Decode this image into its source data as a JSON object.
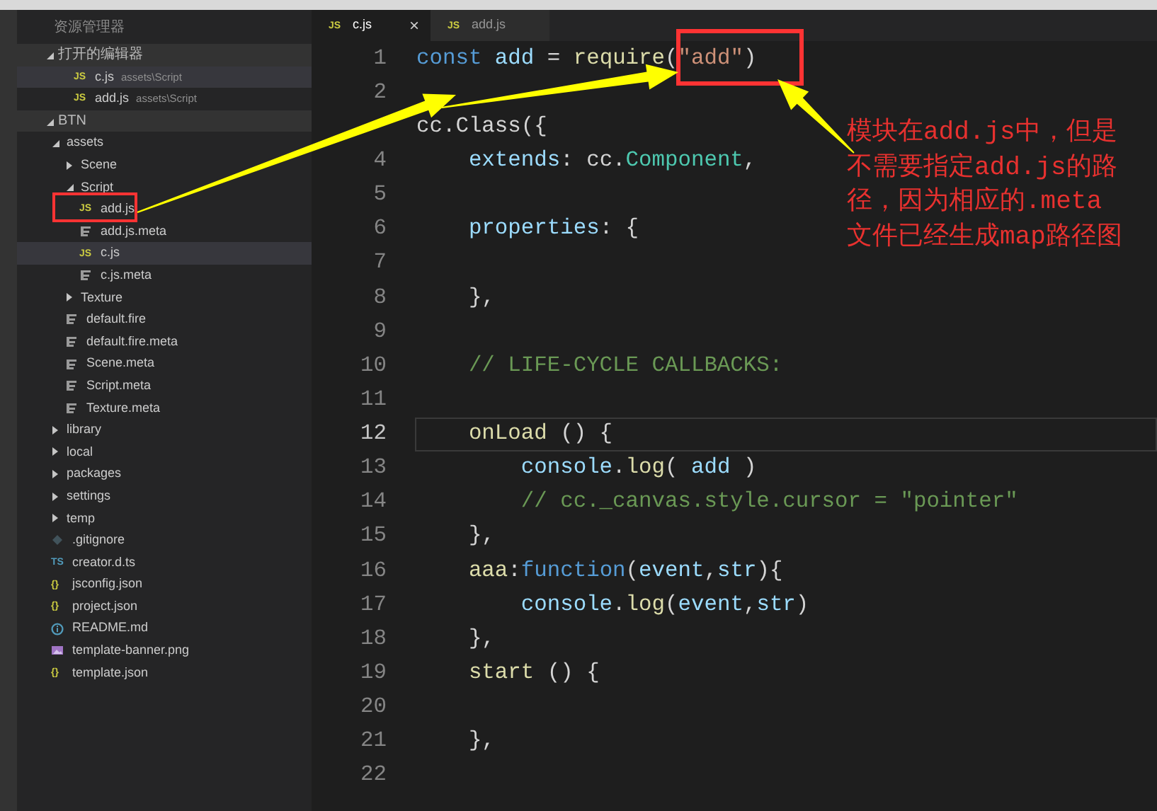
{
  "sidebar": {
    "title": "资源管理器",
    "open_editors": {
      "title": "打开的编辑器",
      "expanded": true,
      "items": [
        {
          "name": "c.js",
          "path": "assets\\Script",
          "kind": "js",
          "icon_text": "JS",
          "selected": true
        },
        {
          "name": "add.js",
          "path": "assets\\Script",
          "kind": "js",
          "icon_text": "JS",
          "selected": false
        }
      ]
    },
    "project": {
      "title": "BTN",
      "expanded": true,
      "children": [
        {
          "name": "assets",
          "kind": "folder",
          "expanded": true,
          "selected": false,
          "children": [
            {
              "name": "Scene",
              "kind": "folder",
              "expanded": false,
              "selected": false
            },
            {
              "name": "Script",
              "kind": "folder",
              "expanded": true,
              "selected": false,
              "children": [
                {
                  "name": "add.js",
                  "kind": "js",
                  "icon_text": "JS",
                  "selected": false
                },
                {
                  "name": "add.js.meta",
                  "kind": "meta",
                  "selected": false
                },
                {
                  "name": "c.js",
                  "kind": "js",
                  "icon_text": "JS",
                  "selected": true
                },
                {
                  "name": "c.js.meta",
                  "kind": "meta",
                  "selected": false
                }
              ]
            },
            {
              "name": "Texture",
              "kind": "folder",
              "expanded": false,
              "selected": false
            },
            {
              "name": "default.fire",
              "kind": "meta",
              "selected": false
            },
            {
              "name": "default.fire.meta",
              "kind": "meta",
              "selected": false
            },
            {
              "name": "Scene.meta",
              "kind": "meta",
              "selected": false
            },
            {
              "name": "Script.meta",
              "kind": "meta",
              "selected": false
            },
            {
              "name": "Texture.meta",
              "kind": "meta",
              "selected": false
            }
          ]
        },
        {
          "name": "library",
          "kind": "folder",
          "expanded": false,
          "selected": false
        },
        {
          "name": "local",
          "kind": "folder",
          "expanded": false,
          "selected": false
        },
        {
          "name": "packages",
          "kind": "folder",
          "expanded": false,
          "selected": false
        },
        {
          "name": "settings",
          "kind": "folder",
          "expanded": false,
          "selected": false
        },
        {
          "name": "temp",
          "kind": "folder",
          "expanded": false,
          "selected": false
        },
        {
          "name": ".gitignore",
          "kind": "git",
          "selected": false
        },
        {
          "name": "creator.d.ts",
          "kind": "ts",
          "icon_text": "TS",
          "selected": false
        },
        {
          "name": "jsconfig.json",
          "kind": "json",
          "icon_text": "{}",
          "selected": false
        },
        {
          "name": "project.json",
          "kind": "json",
          "icon_text": "{}",
          "selected": false
        },
        {
          "name": "README.md",
          "kind": "info",
          "selected": false
        },
        {
          "name": "template-banner.png",
          "kind": "image",
          "selected": false
        },
        {
          "name": "template.json",
          "kind": "json",
          "icon_text": "{}",
          "selected": false
        }
      ]
    }
  },
  "tabs": [
    {
      "label": "c.js",
      "icon_text": "JS",
      "selected": true,
      "close": "×"
    },
    {
      "label": "add.js",
      "icon_text": "JS",
      "selected": false
    }
  ],
  "code_lines": [
    {
      "number": "1",
      "current": false,
      "tokens": [
        {
          "text": "const ",
          "kind": "keyword"
        },
        {
          "text": "add",
          "kind": "variable"
        },
        {
          "text": " = ",
          "kind": "plain"
        },
        {
          "text": "require",
          "kind": "function"
        },
        {
          "text": "(",
          "kind": "plain"
        },
        {
          "text": "\"add\"",
          "kind": "string"
        },
        {
          "text": ")",
          "kind": "plain"
        }
      ]
    },
    {
      "number": "2",
      "current": false
    },
    {
      "current": false,
      "tokens": [
        {
          "text": "cc.Class({",
          "kind": "plain"
        }
      ]
    },
    {
      "number": "4",
      "current": false,
      "tokens": [
        {
          "text": "    extends",
          "kind": "variable"
        },
        {
          "text": ": cc.",
          "kind": "plain"
        },
        {
          "text": "Component",
          "kind": "type"
        },
        {
          "text": ",",
          "kind": "plain"
        }
      ]
    },
    {
      "number": "5",
      "current": false
    },
    {
      "number": "6",
      "current": false,
      "tokens": [
        {
          "text": "    properties",
          "kind": "variable"
        },
        {
          "text": ": {",
          "kind": "plain"
        }
      ]
    },
    {
      "number": "7",
      "current": false
    },
    {
      "number": "8",
      "current": false,
      "tokens": [
        {
          "text": "    },",
          "kind": "plain"
        }
      ]
    },
    {
      "number": "9",
      "current": false
    },
    {
      "number": "10",
      "current": false,
      "tokens": [
        {
          "text": "    // LIFE-CYCLE CALLBACKS:",
          "kind": "comment"
        }
      ]
    },
    {
      "number": "11",
      "current": false
    },
    {
      "number": "12",
      "current": true,
      "tokens": [
        {
          "text": "    onLoad",
          "kind": "function"
        },
        {
          "text": " () {",
          "kind": "plain"
        }
      ]
    },
    {
      "number": "13",
      "current": false,
      "tokens": [
        {
          "text": "        console",
          "kind": "variable"
        },
        {
          "text": ".",
          "kind": "plain"
        },
        {
          "text": "log",
          "kind": "function"
        },
        {
          "text": "( ",
          "kind": "plain"
        },
        {
          "text": "add",
          "kind": "variable"
        },
        {
          "text": " )",
          "kind": "plain"
        }
      ]
    },
    {
      "number": "14",
      "current": false,
      "tokens": [
        {
          "text": "        // cc._canvas.style.cursor = \"pointer\"",
          "kind": "comment"
        }
      ]
    },
    {
      "number": "15",
      "current": false,
      "tokens": [
        {
          "text": "    },",
          "kind": "plain"
        }
      ]
    },
    {
      "number": "16",
      "current": false,
      "tokens": [
        {
          "text": "    aaa",
          "kind": "function"
        },
        {
          "text": ":",
          "kind": "plain"
        },
        {
          "text": "function",
          "kind": "keyword"
        },
        {
          "text": "(",
          "kind": "plain"
        },
        {
          "text": "event",
          "kind": "variable"
        },
        {
          "text": ",",
          "kind": "plain"
        },
        {
          "text": "str",
          "kind": "variable"
        },
        {
          "text": "){",
          "kind": "plain"
        }
      ]
    },
    {
      "number": "17",
      "current": false,
      "tokens": [
        {
          "text": "        console",
          "kind": "variable"
        },
        {
          "text": ".",
          "kind": "plain"
        },
        {
          "text": "log",
          "kind": "function"
        },
        {
          "text": "(",
          "kind": "plain"
        },
        {
          "text": "event",
          "kind": "variable"
        },
        {
          "text": ",",
          "kind": "plain"
        },
        {
          "text": "str",
          "kind": "variable"
        },
        {
          "text": ")",
          "kind": "plain"
        }
      ]
    },
    {
      "number": "18",
      "current": false,
      "tokens": [
        {
          "text": "    },",
          "kind": "plain"
        }
      ]
    },
    {
      "number": "19",
      "current": false,
      "tokens": [
        {
          "text": "    start",
          "kind": "function"
        },
        {
          "text": " () {",
          "kind": "plain"
        }
      ]
    },
    {
      "number": "20",
      "current": false
    },
    {
      "number": "21",
      "current": false,
      "tokens": [
        {
          "text": "    },",
          "kind": "plain"
        }
      ]
    },
    {
      "number": "22",
      "current": false
    }
  ],
  "annotation": {
    "note": "模块在add.js中，但是不需要指定add.js的路径，因为相应的.meta文件已经生成map路径图"
  }
}
